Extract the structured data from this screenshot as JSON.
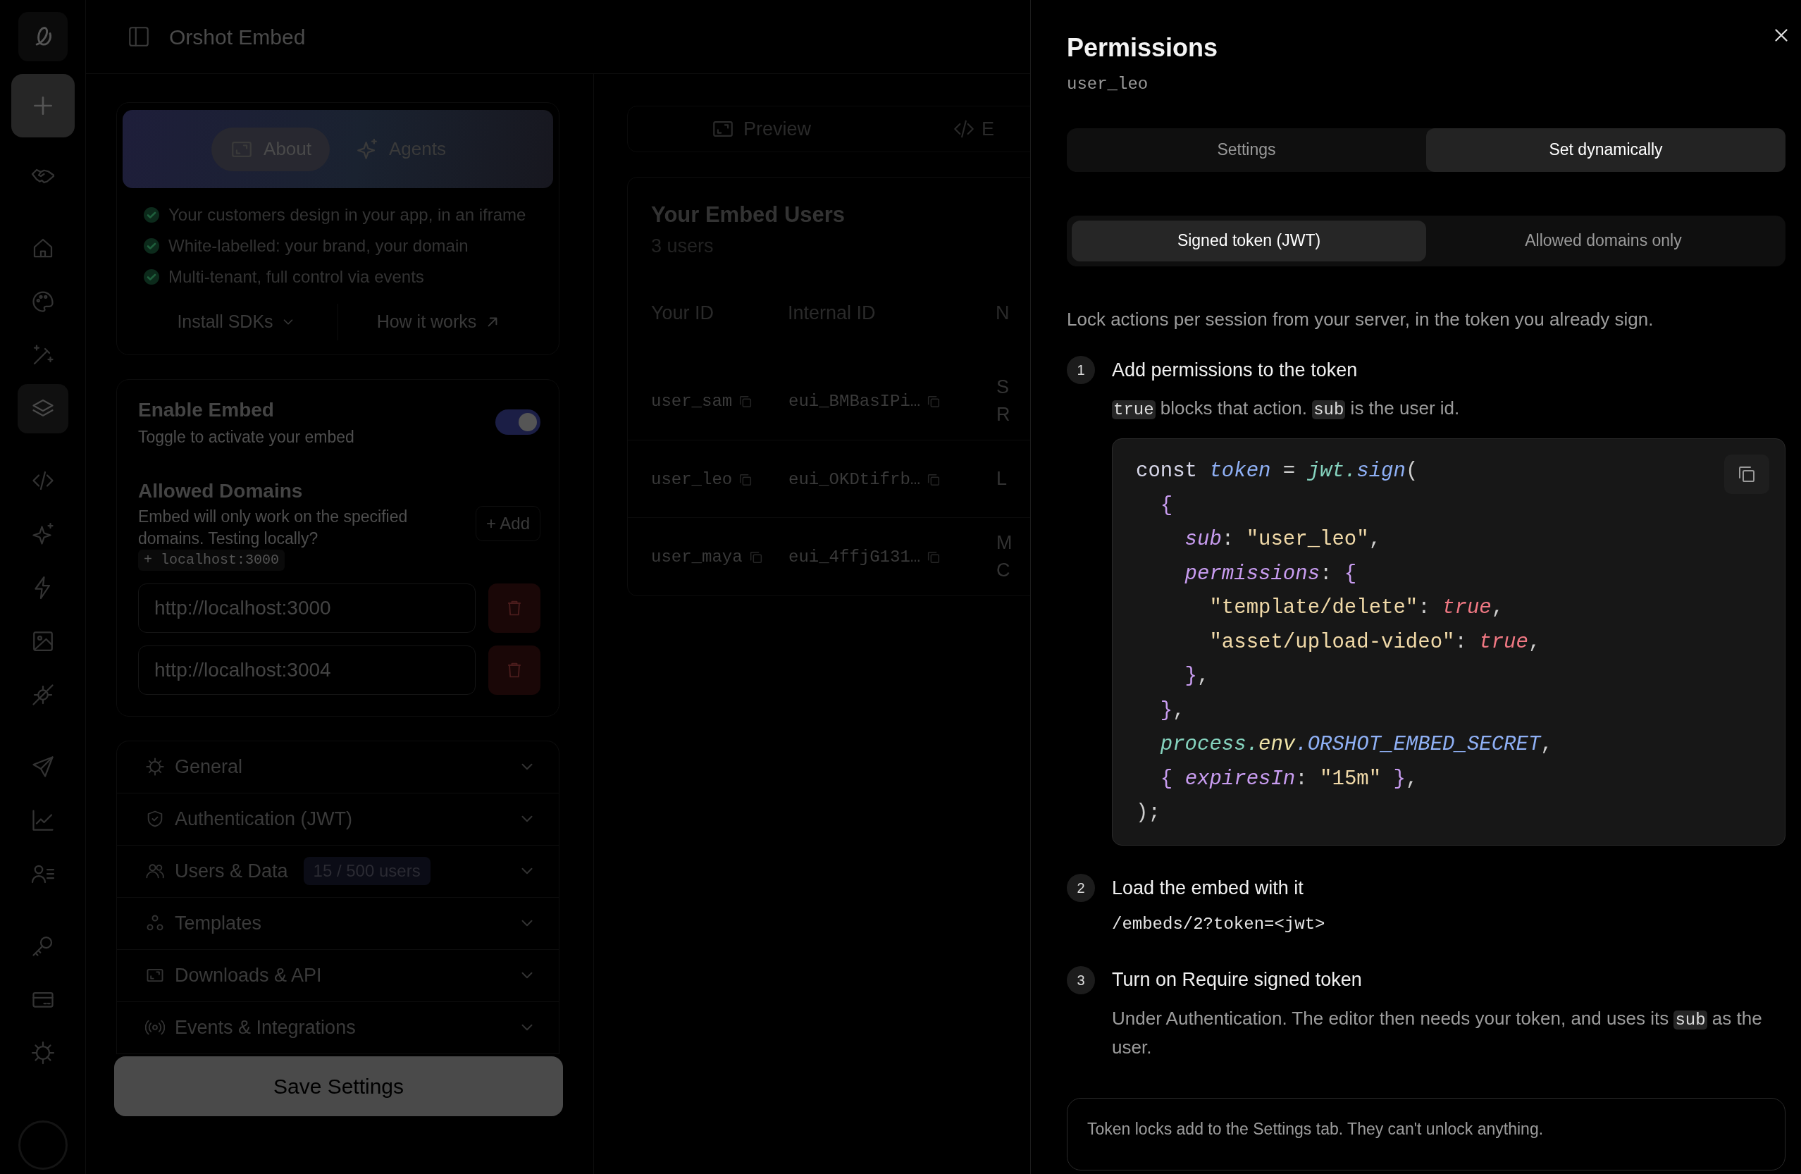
{
  "header": {
    "title": "Orshot Embed"
  },
  "rail": {
    "items": [
      {
        "selected": false
      },
      {
        "selected": false
      },
      {
        "selected": false
      },
      {
        "selected": false
      },
      {
        "selected": true
      },
      {
        "selected": false
      },
      {
        "selected": false
      },
      {
        "selected": false
      },
      {
        "selected": false
      },
      {
        "selected": false
      },
      {
        "selected": false
      },
      {
        "selected": false
      },
      {
        "selected": false
      },
      {
        "selected": false
      },
      {
        "selected": false
      },
      {
        "selected": false
      }
    ]
  },
  "about_card": {
    "tabs": [
      {
        "label": "About",
        "selected": true
      },
      {
        "label": "Agents",
        "selected": false
      }
    ],
    "features": [
      "Your customers design in your app, in an iframe",
      "White-labelled: your brand, your domain",
      "Multi-tenant, full control via events"
    ],
    "links": [
      {
        "label": "Install SDKs",
        "kind": "dropdown"
      },
      {
        "label": "How it works",
        "kind": "external"
      }
    ]
  },
  "embed_settings": {
    "enable": {
      "title": "Enable Embed",
      "subtitle": "Toggle to activate your embed",
      "on": true
    },
    "allowed_domains": {
      "title": "Allowed Domains",
      "description": "Embed will only work on the specified domains. Testing locally?",
      "suggestion": "+ localhost:3000",
      "add_button": "+ Add",
      "domains": [
        {
          "value": "http://localhost:3000"
        },
        {
          "value": "http://localhost:3004"
        }
      ]
    }
  },
  "sections": [
    {
      "label": "General",
      "expanded": false
    },
    {
      "label": "Authentication (JWT)",
      "expanded": false
    },
    {
      "label": "Users & Data",
      "badge": "15 / 500 users",
      "expanded": false
    },
    {
      "label": "Templates",
      "expanded": false
    },
    {
      "label": "Downloads & API",
      "expanded": false
    },
    {
      "label": "Events & Integrations",
      "expanded": false
    }
  ],
  "save_button": "Save Settings",
  "view_tabs": [
    {
      "label": "Preview"
    },
    {
      "label": "E"
    }
  ],
  "users_table": {
    "title": "Your Embed Users",
    "count": "3 users",
    "columns": [
      "Your ID",
      "Internal ID",
      "N"
    ],
    "rows": [
      {
        "cells": [
          "user_sam",
          "eui_BMBasIPi…",
          "S R"
        ]
      },
      {
        "cells": [
          "user_leo",
          "eui_OKDtifrb…",
          "L"
        ]
      },
      {
        "cells": [
          "user_maya",
          "eui_4ffjG131…",
          "M C"
        ]
      }
    ]
  },
  "drawer": {
    "title": "Permissions",
    "subtitle": "user_leo",
    "mode_tabs": [
      {
        "label": "Settings",
        "selected": false
      },
      {
        "label": "Set dynamically",
        "selected": true
      }
    ],
    "method_tabs": [
      {
        "label": "Signed token (JWT)",
        "selected": true
      },
      {
        "label": "Allowed domains only",
        "selected": false
      }
    ],
    "intro": "Lock actions per session from your server, in the token you already sign.",
    "steps": [
      {
        "number": "1",
        "title": "Add permissions to the token",
        "body": [
          {
            "kind": "code",
            "text": "true"
          },
          {
            "kind": "text",
            "text": " blocks that action. "
          },
          {
            "kind": "code",
            "text": "sub"
          },
          {
            "kind": "text",
            "text": " is the user id."
          }
        ],
        "code": [
          [
            {
              "kind": "keyword",
              "text": "const "
            },
            {
              "kind": "name",
              "text": "token"
            },
            {
              "kind": "punct",
              "text": " = "
            },
            {
              "kind": "object",
              "text": "jwt."
            },
            {
              "kind": "method",
              "text": "sign"
            },
            {
              "kind": "punct",
              "text": "("
            }
          ],
          [
            {
              "kind": "brace",
              "text": "  {"
            }
          ],
          [
            {
              "kind": "property",
              "text": "    sub"
            },
            {
              "kind": "punct",
              "text": ": "
            },
            {
              "kind": "string",
              "text": "\"user_leo\""
            },
            {
              "kind": "punct",
              "text": ","
            }
          ],
          [
            {
              "kind": "property",
              "text": "    permissions"
            },
            {
              "kind": "punct",
              "text": ": "
            },
            {
              "kind": "brace",
              "text": "{"
            }
          ],
          [
            {
              "kind": "string",
              "text": "      \"template/delete\""
            },
            {
              "kind": "punct",
              "text": ": "
            },
            {
              "kind": "boolean",
              "text": "true"
            },
            {
              "kind": "punct",
              "text": ","
            }
          ],
          [
            {
              "kind": "string",
              "text": "      \"asset/upload-video\""
            },
            {
              "kind": "punct",
              "text": ": "
            },
            {
              "kind": "boolean",
              "text": "true"
            },
            {
              "kind": "punct",
              "text": ","
            }
          ],
          [
            {
              "kind": "brace",
              "text": "    }"
            },
            {
              "kind": "punct",
              "text": ","
            }
          ],
          [
            {
              "kind": "brace",
              "text": "  }"
            },
            {
              "kind": "punct",
              "text": ","
            }
          ],
          [
            {
              "kind": "object",
              "text": "  process."
            },
            {
              "kind": "env",
              "text": "env"
            },
            {
              "kind": "constant",
              "text": ".ORSHOT_EMBED_SECRET"
            },
            {
              "kind": "punct",
              "text": ","
            }
          ],
          [
            {
              "kind": "brace",
              "text": "  { "
            },
            {
              "kind": "property",
              "text": "expiresIn"
            },
            {
              "kind": "punct",
              "text": ": "
            },
            {
              "kind": "string",
              "text": "\"15m\""
            },
            {
              "kind": "brace",
              "text": " }"
            },
            {
              "kind": "punct",
              "text": ","
            }
          ],
          [
            {
              "kind": "punct",
              "text": ");"
            }
          ]
        ]
      },
      {
        "number": "2",
        "title": "Load the embed with it",
        "path": "/embeds/2?token=<jwt>"
      },
      {
        "number": "3",
        "title": "Turn on Require signed token",
        "body": [
          {
            "kind": "text",
            "text": "Under Authentication. The editor then needs your token, and uses its "
          },
          {
            "kind": "code",
            "text": "sub"
          },
          {
            "kind": "text",
            "text": " as the user."
          }
        ]
      }
    ],
    "note": "Token locks add to the Settings tab. They can't unlock anything."
  }
}
